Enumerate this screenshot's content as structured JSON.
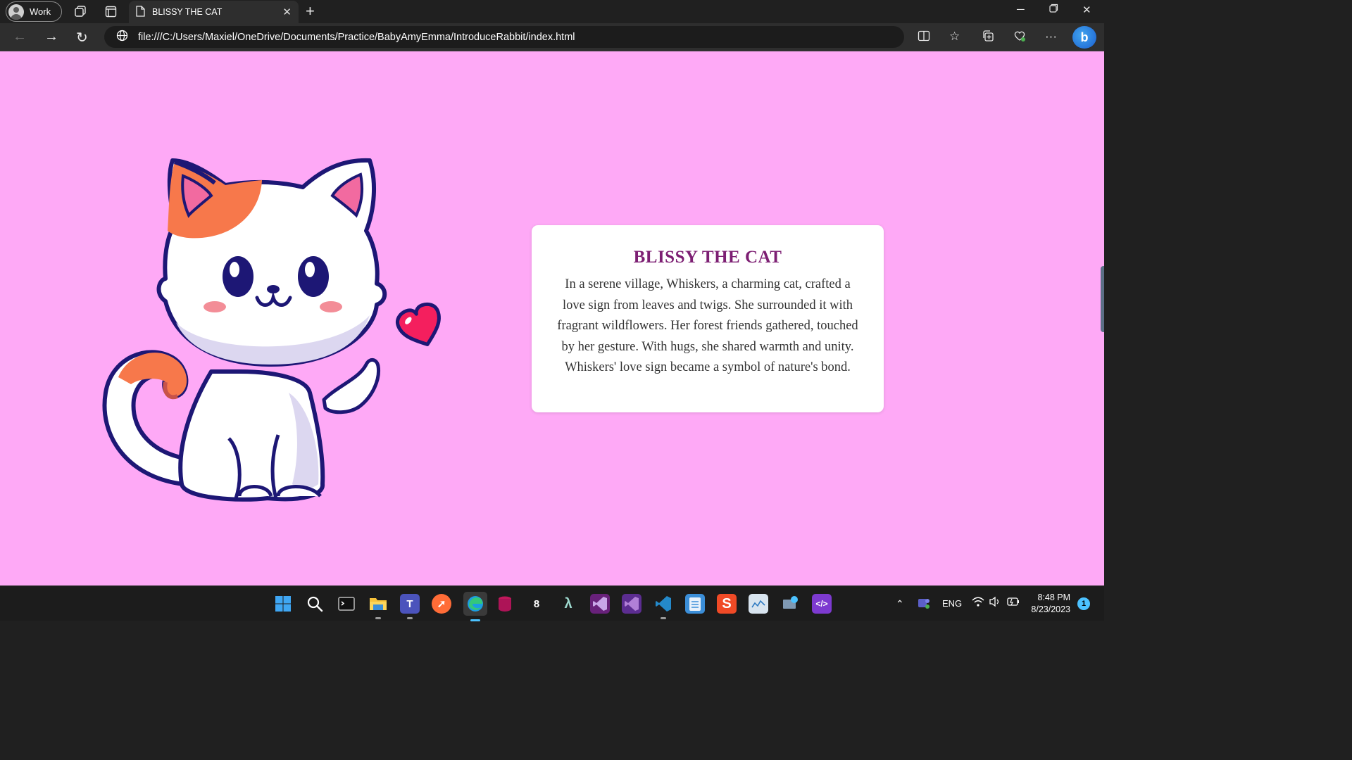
{
  "browser": {
    "profile_label": "Work",
    "tab_title": "BLISSY THE CAT",
    "url": "file:///C:/Users/Maxiel/OneDrive/Documents/Practice/BabyAmyEmma/IntroduceRabbit/index.html"
  },
  "page": {
    "heading": "BLISSY THE CAT",
    "story": "In a serene village, Whiskers, a charming cat, crafted a love sign from leaves and twigs. She surrounded it with fragrant wildflowers. Her forest friends gathered, touched by her gesture. With hugs, she shared warmth and unity. Whiskers' love sign became a symbol of nature's bond.",
    "background_color": "#fea9f6",
    "heading_color": "#7d1f73"
  },
  "taskbar": {
    "language": "ENG",
    "time": "8:48 PM",
    "date": "8/23/2023",
    "notification_count": "1"
  }
}
